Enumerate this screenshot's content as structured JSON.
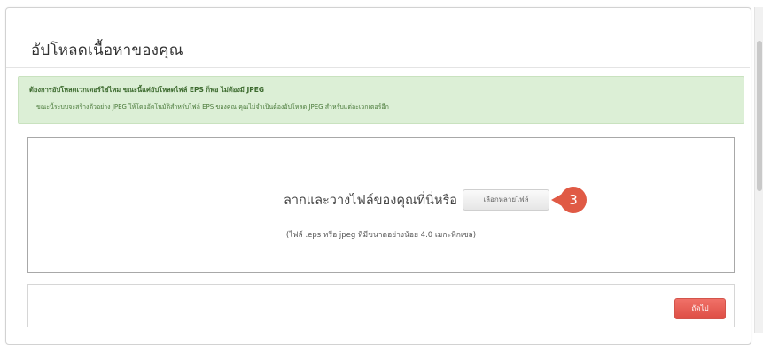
{
  "page": {
    "title": "อัปโหลดเนื้อหาของคุณ"
  },
  "notice": {
    "heading": "ต้องการอัปโหลดเวกเตอร์ใช่ไหม ขณะนี้แค่อัปโหลดไฟล์ EPS ก็พอ ไม่ต้องมี JPEG",
    "body": "ขณะนี้ระบบจะสร้างตัวอย่าง JPEG ให้โดยอัตโนมัติสำหรับไฟล์ EPS ของคุณ คุณไม่จำเป็นต้องอัปโหลด JPEG สำหรับแต่ละเวกเตอร์อีก"
  },
  "dropzone": {
    "prompt": "ลากและวางไฟล์ของคุณที่นี่หรือ",
    "choose_button": "เลือกหลายไฟล์",
    "hint": "(ไฟล์ .eps หรือ jpeg ที่มีขนาดอย่างน้อย 4.0 เมกะพิกเซล)"
  },
  "callout": {
    "number": "3",
    "color": "#e05a45"
  },
  "footer": {
    "next_button": "ถัดไป"
  },
  "colors": {
    "notice_bg": "#dcefd6",
    "next_button": "#e25a50"
  }
}
